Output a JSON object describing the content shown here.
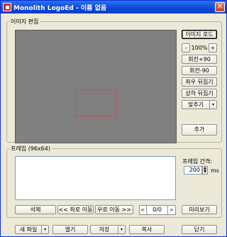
{
  "window": {
    "title": "Monolith LogoEd - 이름 없음",
    "close_glyph": "✕"
  },
  "editor": {
    "legend": "이미지 편집",
    "load_image": "이미지 로드",
    "zoom_minus": "-",
    "zoom_value": "100%",
    "zoom_plus": "+",
    "rotate_cw": "회전+90",
    "rotate_ccw": "회전-90",
    "flip_h": "좌우 뒤집기",
    "flip_v": "상하 뒤집기",
    "fit": "맞추기",
    "fit_arrow": "▾",
    "add": "추가"
  },
  "frames": {
    "legend": "프레임 (96x64)",
    "interval_label": "프레임 간격:",
    "interval_value": "200",
    "interval_unit": "ms",
    "delete": "삭제",
    "move_left": "<< 좌로 이동",
    "move_right": "우로 이동 >>",
    "prev": "<",
    "counter": "0/0",
    "next": ">",
    "preview": "미리보기"
  },
  "footer": {
    "new_file": "새 파일",
    "new_arrow": "▾",
    "open": "열기",
    "save": "저장",
    "save_arrow": "▾",
    "copy": "복사",
    "close": "닫기"
  }
}
